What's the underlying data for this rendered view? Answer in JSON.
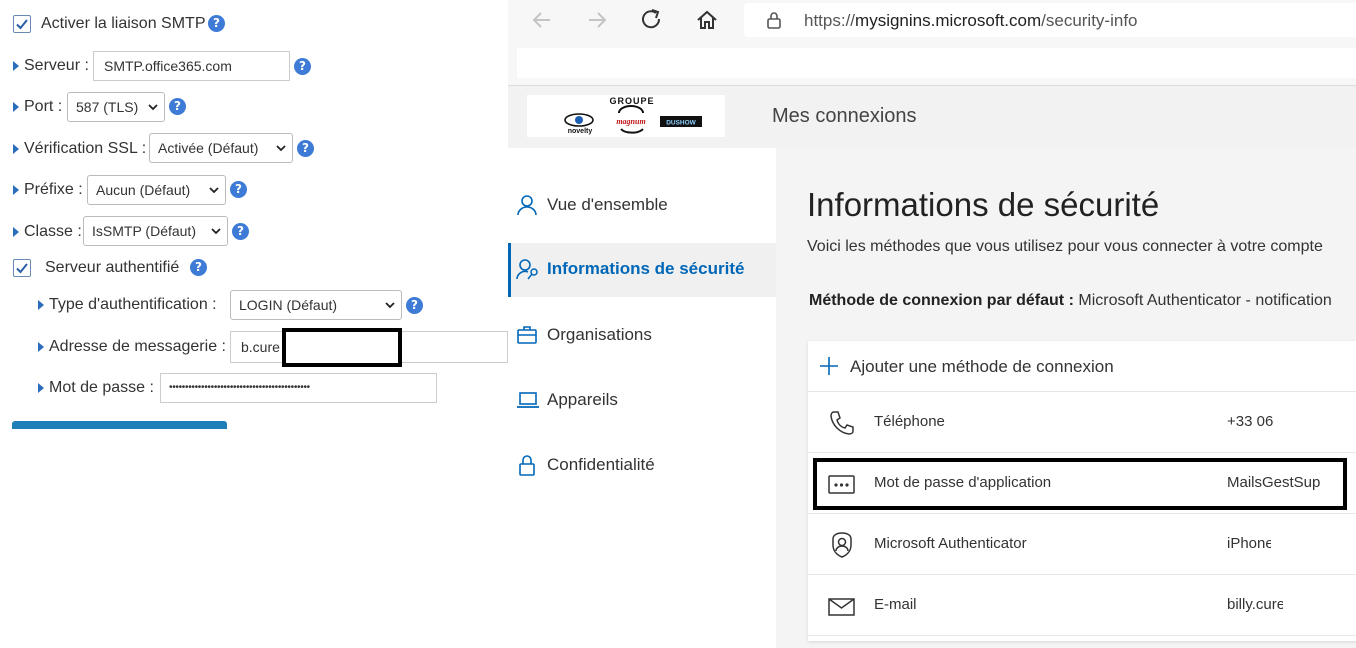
{
  "smtp": {
    "enable_label": "Activer la liaison SMTP",
    "server_label": "Serveur :",
    "server_value": "SMTP.office365.com",
    "port_label": "Port :",
    "port_value": "587 (TLS)",
    "ssl_label": "Vérification SSL :",
    "ssl_value": "Activée (Défaut)",
    "prefix_label": "Préfixe :",
    "prefix_value": "Aucun (Défaut)",
    "class_label": "Classe :",
    "class_value": "IsSMTP (Défaut)",
    "auth_label": "Serveur authentifié",
    "auth_type_label": "Type d'authentification :",
    "auth_type_value": "LOGIN (Défaut)",
    "email_label": "Adresse de messagerie :",
    "email_value": "b.cure",
    "password_label": "Mot de passe :",
    "password_value": "••••••••••••••••••••••••••••••••••••••••••••",
    "help_glyph": "?"
  },
  "browser": {
    "url_prefix": "https://",
    "url_host": "mysignins.microsoft.com",
    "url_path": "/security-info"
  },
  "header": {
    "logo_text": "GROUPE",
    "logo_brands": [
      "novelty",
      "magnum",
      "DUSHOW"
    ],
    "app_title": "Mes connexions"
  },
  "sidebar": {
    "items": [
      {
        "label": "Vue d'ensemble",
        "icon": "person-icon"
      },
      {
        "label": "Informations de sécurité",
        "icon": "person-key-icon",
        "active": true
      },
      {
        "label": "Organisations",
        "icon": "briefcase-icon"
      },
      {
        "label": "Appareils",
        "icon": "laptop-icon"
      },
      {
        "label": "Confidentialité",
        "icon": "lock-icon"
      }
    ]
  },
  "main": {
    "title": "Informations de sécurité",
    "description": "Voici les méthodes que vous utilisez pour vous connecter à votre compte",
    "default_label": "Méthode de connexion par défaut :",
    "default_value": "Microsoft Authenticator - notification",
    "add_method": "Ajouter une méthode de connexion",
    "methods": [
      {
        "name": "Téléphone",
        "value": "+33 06",
        "icon": "phone-icon"
      },
      {
        "name": "Mot de passe d'application",
        "value": "MailsGestSup",
        "icon": "password-dots-icon"
      },
      {
        "name": "Microsoft Authenticator",
        "value": "iPhone",
        "icon": "authenticator-icon"
      },
      {
        "name": "E-mail",
        "value": "billy.cure",
        "icon": "mail-icon"
      }
    ]
  }
}
